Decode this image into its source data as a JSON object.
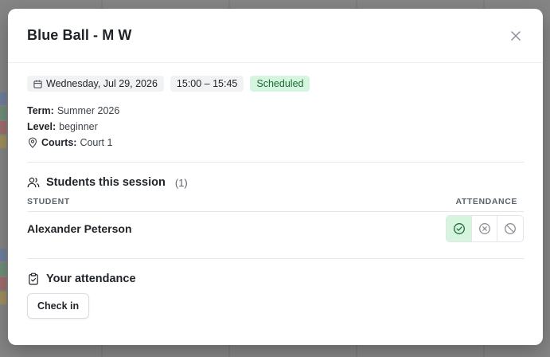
{
  "modal": {
    "title": "Blue Ball - M W",
    "date": "Wednesday, Jul 29, 2026",
    "time": "15:00 – 15:45",
    "status": "Scheduled",
    "term_label": "Term:",
    "term_value": "Summer 2026",
    "level_label": "Level:",
    "level_value": "beginner",
    "courts_label": "Courts:",
    "courts_value": "Court 1"
  },
  "students": {
    "title": "Students this session",
    "count": "(1)",
    "col_student": "STUDENT",
    "col_attendance": "ATTENDANCE",
    "rows": [
      {
        "name": "Alexander Peterson",
        "attendance": "present"
      }
    ]
  },
  "your_attendance": {
    "title": "Your attendance",
    "checkin_label": "Check in"
  },
  "colors": {
    "status_bg": "#d6f5df",
    "status_text": "#1b6b37"
  }
}
